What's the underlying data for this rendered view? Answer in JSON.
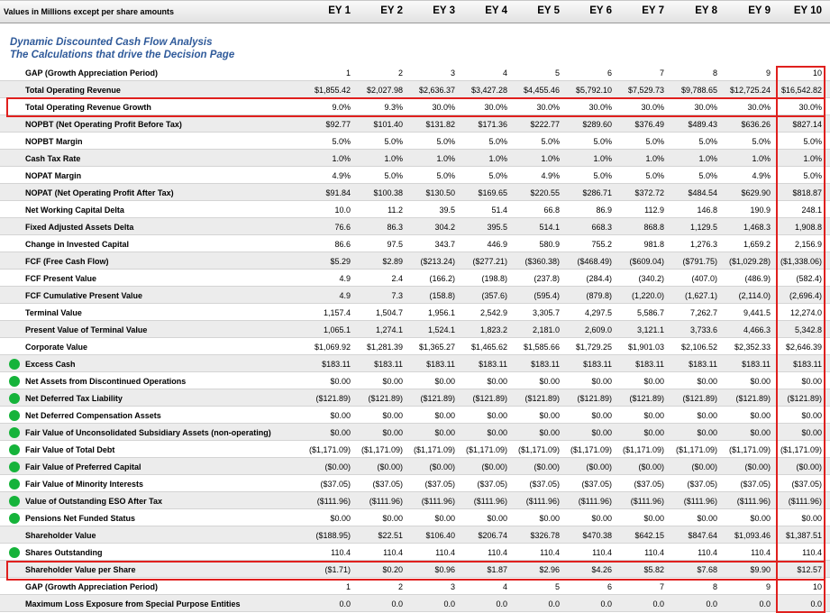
{
  "header": {
    "units_label": "Values in Millions except per share amounts",
    "years": [
      "EY 1",
      "EY 2",
      "EY 3",
      "EY 4",
      "EY 5",
      "EY 6",
      "EY 7",
      "EY 8",
      "EY 9",
      "EY 10"
    ]
  },
  "titles": {
    "line1": "Dynamic Discounted Cash Flow Analysis",
    "line2": "The Calculations that drive the Decision Page"
  },
  "colors": {
    "title": "#2f5a9a",
    "highlight_box": "#e0201e",
    "dot": "#15b33a"
  },
  "rows": [
    {
      "label": "GAP (Growth Appreciation Period)",
      "dot": false,
      "values": [
        "1",
        "2",
        "3",
        "4",
        "5",
        "6",
        "7",
        "8",
        "9",
        "10"
      ]
    },
    {
      "label": "Total Operating Revenue",
      "dot": false,
      "values": [
        "$1,855.42",
        "$2,027.98",
        "$2,636.37",
        "$3,427.28",
        "$4,455.46",
        "$5,792.10",
        "$7,529.73",
        "$9,788.65",
        "$12,725.24",
        "$16,542.82"
      ]
    },
    {
      "label": "Total Operating Revenue Growth",
      "dot": false,
      "values": [
        "9.0%",
        "9.3%",
        "30.0%",
        "30.0%",
        "30.0%",
        "30.0%",
        "30.0%",
        "30.0%",
        "30.0%",
        "30.0%"
      ]
    },
    {
      "label": "NOPBT (Net Operating Profit Before Tax)",
      "dot": false,
      "values": [
        "$92.77",
        "$101.40",
        "$131.82",
        "$171.36",
        "$222.77",
        "$289.60",
        "$376.49",
        "$489.43",
        "$636.26",
        "$827.14"
      ]
    },
    {
      "label": "NOPBT Margin",
      "dot": false,
      "values": [
        "5.0%",
        "5.0%",
        "5.0%",
        "5.0%",
        "5.0%",
        "5.0%",
        "5.0%",
        "5.0%",
        "5.0%",
        "5.0%"
      ]
    },
    {
      "label": "Cash Tax Rate",
      "dot": false,
      "values": [
        "1.0%",
        "1.0%",
        "1.0%",
        "1.0%",
        "1.0%",
        "1.0%",
        "1.0%",
        "1.0%",
        "1.0%",
        "1.0%"
      ]
    },
    {
      "label": "NOPAT Margin",
      "dot": false,
      "values": [
        "4.9%",
        "5.0%",
        "5.0%",
        "5.0%",
        "4.9%",
        "5.0%",
        "5.0%",
        "5.0%",
        "4.9%",
        "5.0%"
      ]
    },
    {
      "label": "NOPAT (Net Operating Profit After Tax)",
      "dot": false,
      "values": [
        "$91.84",
        "$100.38",
        "$130.50",
        "$169.65",
        "$220.55",
        "$286.71",
        "$372.72",
        "$484.54",
        "$629.90",
        "$818.87"
      ]
    },
    {
      "label": "Net Working Capital Delta",
      "dot": false,
      "values": [
        "10.0",
        "11.2",
        "39.5",
        "51.4",
        "66.8",
        "86.9",
        "112.9",
        "146.8",
        "190.9",
        "248.1"
      ]
    },
    {
      "label": "Fixed Adjusted Assets Delta",
      "dot": false,
      "values": [
        "76.6",
        "86.3",
        "304.2",
        "395.5",
        "514.1",
        "668.3",
        "868.8",
        "1,129.5",
        "1,468.3",
        "1,908.8"
      ]
    },
    {
      "label": "Change in Invested Capital",
      "dot": false,
      "values": [
        "86.6",
        "97.5",
        "343.7",
        "446.9",
        "580.9",
        "755.2",
        "981.8",
        "1,276.3",
        "1,659.2",
        "2,156.9"
      ]
    },
    {
      "label": "FCF (Free Cash Flow)",
      "dot": false,
      "values": [
        "$5.29",
        "$2.89",
        "($213.24)",
        "($277.21)",
        "($360.38)",
        "($468.49)",
        "($609.04)",
        "($791.75)",
        "($1,029.28)",
        "($1,338.06)"
      ]
    },
    {
      "label": "FCF Present Value",
      "dot": false,
      "values": [
        "4.9",
        "2.4",
        "(166.2)",
        "(198.8)",
        "(237.8)",
        "(284.4)",
        "(340.2)",
        "(407.0)",
        "(486.9)",
        "(582.4)"
      ]
    },
    {
      "label": "FCF Cumulative Present Value",
      "dot": false,
      "values": [
        "4.9",
        "7.3",
        "(158.8)",
        "(357.6)",
        "(595.4)",
        "(879.8)",
        "(1,220.0)",
        "(1,627.1)",
        "(2,114.0)",
        "(2,696.4)"
      ]
    },
    {
      "label": "Terminal Value",
      "dot": false,
      "values": [
        "1,157.4",
        "1,504.7",
        "1,956.1",
        "2,542.9",
        "3,305.7",
        "4,297.5",
        "5,586.7",
        "7,262.7",
        "9,441.5",
        "12,274.0"
      ]
    },
    {
      "label": "Present Value of Terminal Value",
      "dot": false,
      "values": [
        "1,065.1",
        "1,274.1",
        "1,524.1",
        "1,823.2",
        "2,181.0",
        "2,609.0",
        "3,121.1",
        "3,733.6",
        "4,466.3",
        "5,342.8"
      ]
    },
    {
      "label": "Corporate Value",
      "dot": false,
      "values": [
        "$1,069.92",
        "$1,281.39",
        "$1,365.27",
        "$1,465.62",
        "$1,585.66",
        "$1,729.25",
        "$1,901.03",
        "$2,106.52",
        "$2,352.33",
        "$2,646.39"
      ]
    },
    {
      "label": "Excess Cash",
      "dot": true,
      "values": [
        "$183.11",
        "$183.11",
        "$183.11",
        "$183.11",
        "$183.11",
        "$183.11",
        "$183.11",
        "$183.11",
        "$183.11",
        "$183.11"
      ]
    },
    {
      "label": "Net Assets from Discontinued Operations",
      "dot": true,
      "values": [
        "$0.00",
        "$0.00",
        "$0.00",
        "$0.00",
        "$0.00",
        "$0.00",
        "$0.00",
        "$0.00",
        "$0.00",
        "$0.00"
      ]
    },
    {
      "label": "Net Deferred Tax Liability",
      "dot": true,
      "values": [
        "($121.89)",
        "($121.89)",
        "($121.89)",
        "($121.89)",
        "($121.89)",
        "($121.89)",
        "($121.89)",
        "($121.89)",
        "($121.89)",
        "($121.89)"
      ]
    },
    {
      "label": "Net Deferred Compensation Assets",
      "dot": true,
      "values": [
        "$0.00",
        "$0.00",
        "$0.00",
        "$0.00",
        "$0.00",
        "$0.00",
        "$0.00",
        "$0.00",
        "$0.00",
        "$0.00"
      ]
    },
    {
      "label": "Fair Value of Unconsolidated Subsidiary Assets (non-operating)",
      "dot": true,
      "values": [
        "$0.00",
        "$0.00",
        "$0.00",
        "$0.00",
        "$0.00",
        "$0.00",
        "$0.00",
        "$0.00",
        "$0.00",
        "$0.00"
      ]
    },
    {
      "label": "Fair Value of Total Debt",
      "dot": true,
      "values": [
        "($1,171.09)",
        "($1,171.09)",
        "($1,171.09)",
        "($1,171.09)",
        "($1,171.09)",
        "($1,171.09)",
        "($1,171.09)",
        "($1,171.09)",
        "($1,171.09)",
        "($1,171.09)"
      ]
    },
    {
      "label": "Fair Value of Preferred Capital",
      "dot": true,
      "values": [
        "($0.00)",
        "($0.00)",
        "($0.00)",
        "($0.00)",
        "($0.00)",
        "($0.00)",
        "($0.00)",
        "($0.00)",
        "($0.00)",
        "($0.00)"
      ]
    },
    {
      "label": "Fair Value of Minority Interests",
      "dot": true,
      "values": [
        "($37.05)",
        "($37.05)",
        "($37.05)",
        "($37.05)",
        "($37.05)",
        "($37.05)",
        "($37.05)",
        "($37.05)",
        "($37.05)",
        "($37.05)"
      ]
    },
    {
      "label": "Value of Outstanding ESO After Tax",
      "dot": true,
      "values": [
        "($111.96)",
        "($111.96)",
        "($111.96)",
        "($111.96)",
        "($111.96)",
        "($111.96)",
        "($111.96)",
        "($111.96)",
        "($111.96)",
        "($111.96)"
      ]
    },
    {
      "label": "Pensions Net Funded Status",
      "dot": true,
      "values": [
        "$0.00",
        "$0.00",
        "$0.00",
        "$0.00",
        "$0.00",
        "$0.00",
        "$0.00",
        "$0.00",
        "$0.00",
        "$0.00"
      ]
    },
    {
      "label": "Shareholder Value",
      "dot": false,
      "values": [
        "($188.95)",
        "$22.51",
        "$106.40",
        "$206.74",
        "$326.78",
        "$470.38",
        "$642.15",
        "$847.64",
        "$1,093.46",
        "$1,387.51"
      ]
    },
    {
      "label": "Shares Outstanding",
      "dot": true,
      "values": [
        "110.4",
        "110.4",
        "110.4",
        "110.4",
        "110.4",
        "110.4",
        "110.4",
        "110.4",
        "110.4",
        "110.4"
      ]
    },
    {
      "label": "Shareholder Value per Share",
      "dot": false,
      "values": [
        "($1.71)",
        "$0.20",
        "$0.96",
        "$1.87",
        "$2.96",
        "$4.26",
        "$5.82",
        "$7.68",
        "$9.90",
        "$12.57"
      ]
    },
    {
      "label": "GAP (Growth Appreciation Period)",
      "dot": false,
      "values": [
        "1",
        "2",
        "3",
        "4",
        "5",
        "6",
        "7",
        "8",
        "9",
        "10"
      ]
    },
    {
      "label": "Maximum Loss Exposure from Special Purpose Entities",
      "dot": false,
      "values": [
        "0.0",
        "0.0",
        "0.0",
        "0.0",
        "0.0",
        "0.0",
        "0.0",
        "0.0",
        "0.0",
        "0.0"
      ]
    }
  ]
}
